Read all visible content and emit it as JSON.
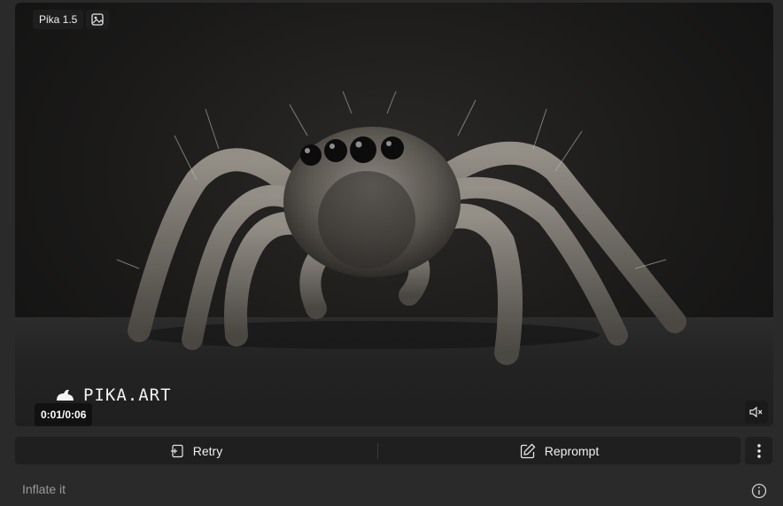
{
  "video": {
    "model_label": "Pika 1.5",
    "image_icon": "image-icon",
    "watermark_text": "PIKA.ART",
    "watermark_icon": "pika-rabbit-logo",
    "time_display": "0:01/0:06",
    "mute_icon": "speaker-muted-icon",
    "subject": "spider"
  },
  "actions": {
    "retry_label": "Retry",
    "retry_icon": "retry-icon",
    "reprompt_label": "Reprompt",
    "reprompt_icon": "edit-icon",
    "more_icon": "more-vertical-icon"
  },
  "prompt": {
    "text": "Inflate it",
    "info_icon": "info-icon"
  }
}
